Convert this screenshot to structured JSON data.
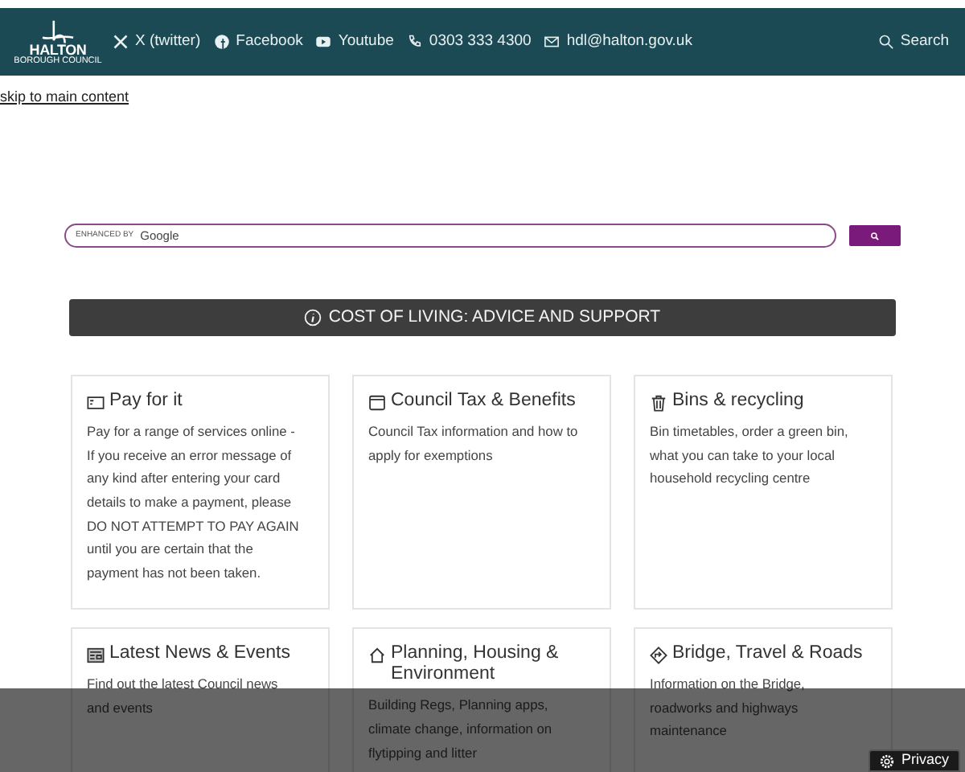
{
  "header": {
    "logo": {
      "name": "HALTON",
      "subtitle": "BOROUGH COUNCIL"
    },
    "links": [
      {
        "kind": "x",
        "label": "X (twitter)"
      },
      {
        "kind": "facebook",
        "label": "Facebook"
      },
      {
        "kind": "youtube",
        "label": "Youtube"
      },
      {
        "kind": "phone",
        "label": "0303 333 4300"
      },
      {
        "kind": "mail",
        "label": "hdl@halton.gov.uk"
      }
    ],
    "search": "Search"
  },
  "skip_link": "skip to main content",
  "site_search": {
    "brand_prefix": "ENHANCED BY",
    "brand": "Google"
  },
  "banner": "COST OF LIVING: ADVICE AND SUPPORT",
  "cards": [
    {
      "kind": "card",
      "title": "Pay for it",
      "text": "Pay for a range of services online - If you receive an error message of any kind after entering your card details to make a payment, please DO NOT ATTEMPT TO PAY AGAIN until you are certain that the payment has not been taken."
    },
    {
      "kind": "window",
      "title": "Council Tax & Benefits",
      "text": "Council Tax information and how to apply for exemptions"
    },
    {
      "kind": "bin",
      "title": "Bins & recycling",
      "text": "Bin timetables, order a green bin, what you can take to your local household recycling centre"
    },
    {
      "kind": "news",
      "title": "Latest News & Events",
      "text": "Find out the latest Council news and events"
    },
    {
      "kind": "house",
      "title": "Planning, Housing & Environment",
      "text": "Building Regs, Planning apps, climate change, information on flytipping and litter"
    },
    {
      "kind": "sign",
      "title": "Bridge, Travel & Roads",
      "text": "Information on the Bridge, roadworks and highways maintenance"
    }
  ],
  "privacy_button": "Privacy"
}
